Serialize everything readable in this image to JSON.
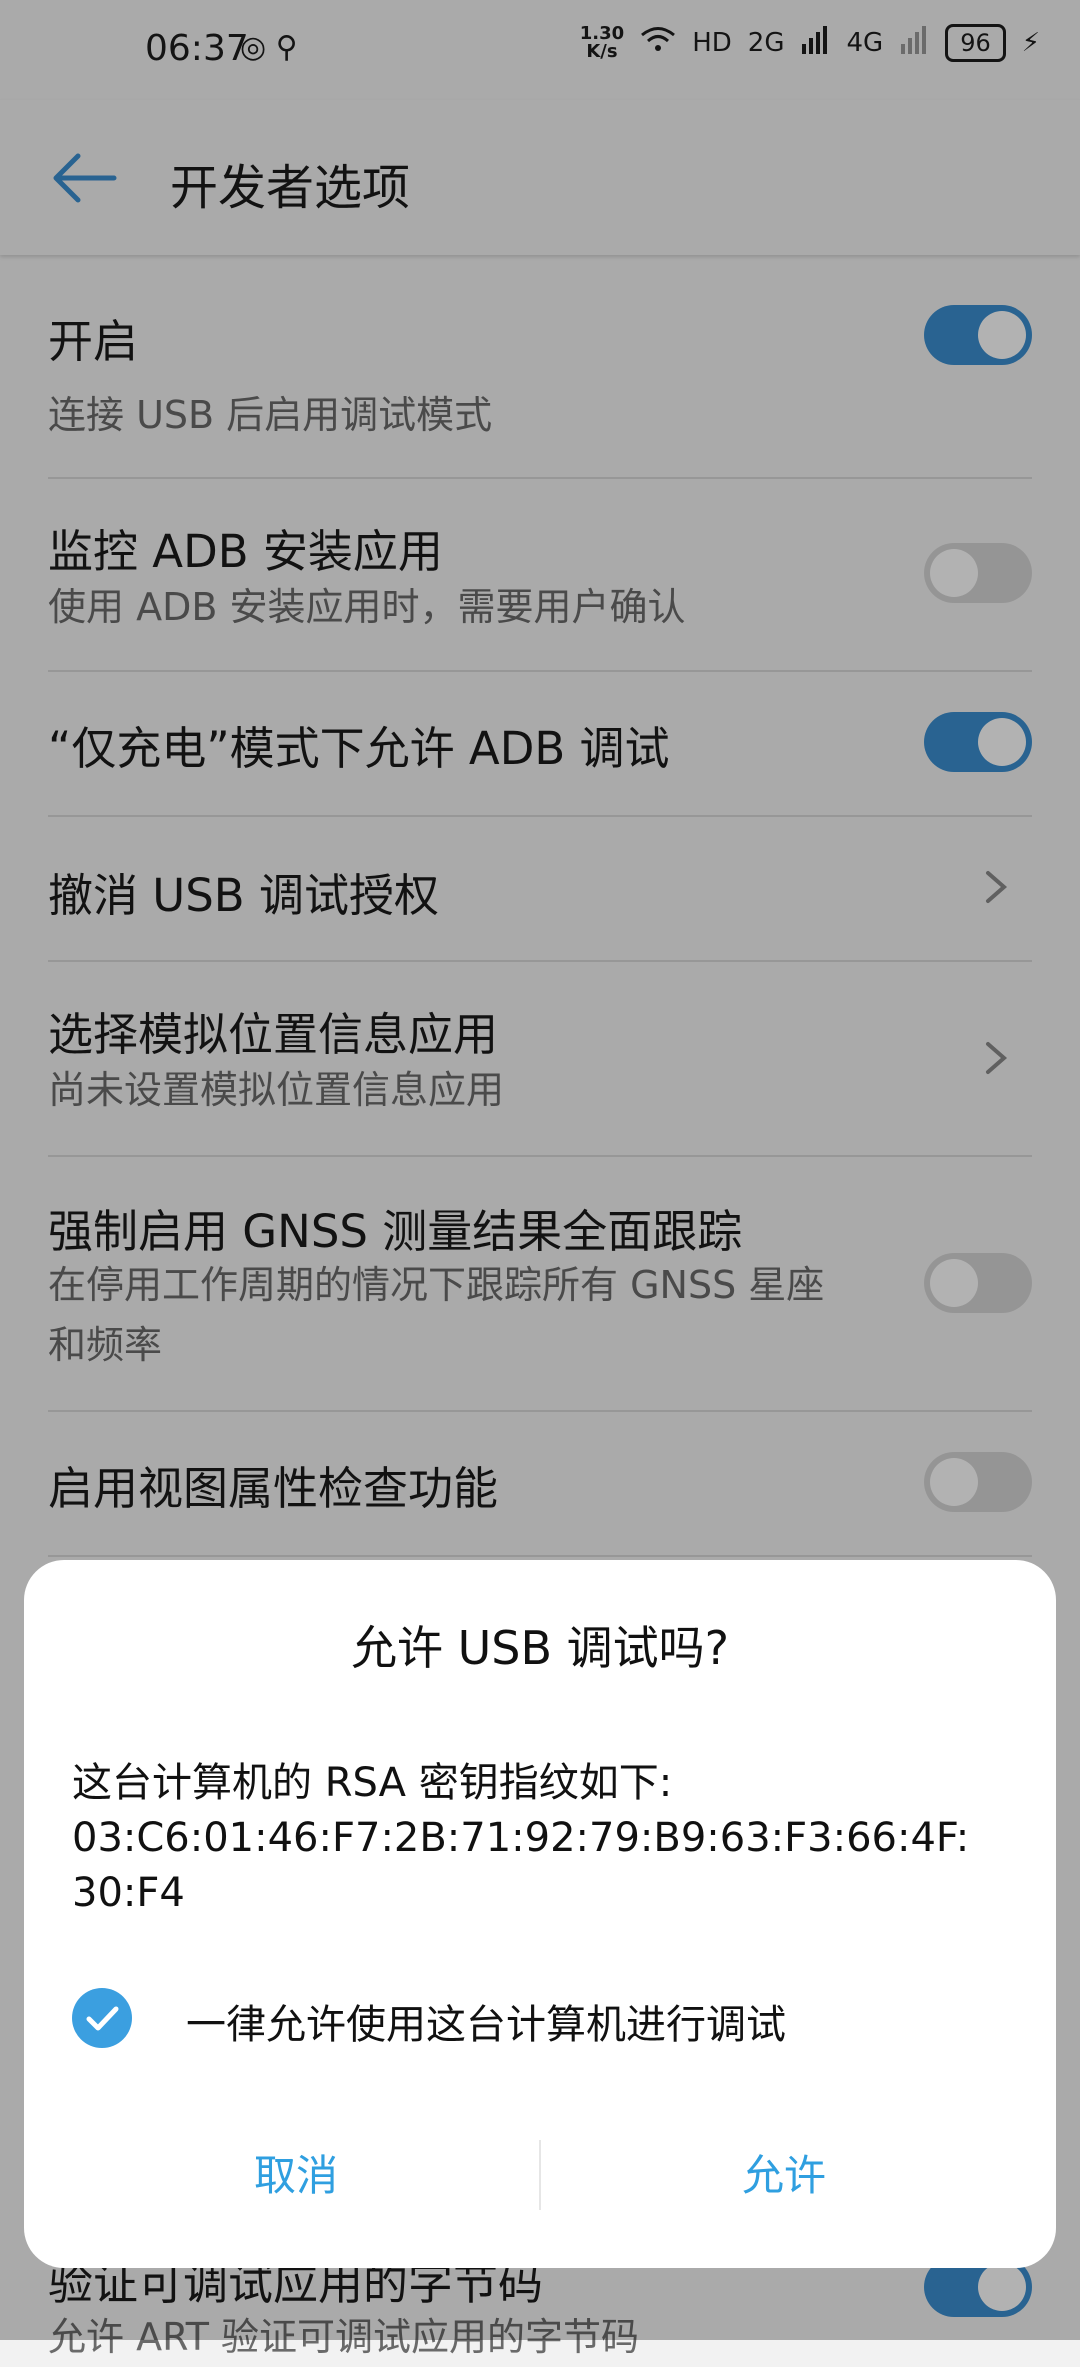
{
  "status_bar": {
    "time": "06:37",
    "net_speed_value": "1.30",
    "net_speed_unit": "K/s",
    "network_hd": "HD",
    "network_2g": "2G",
    "network_4g": "4G",
    "battery": "96"
  },
  "header": {
    "title": "开发者选项"
  },
  "settings": [
    {
      "title": "开启",
      "subtitle": "连接 USB 后启用调试模式",
      "control": "toggle",
      "on": true
    },
    {
      "title": "监控 ADB 安装应用",
      "subtitle": "使用 ADB 安装应用时，需要用户确认",
      "control": "toggle",
      "on": false
    },
    {
      "title": "“仅充电”模式下允许 ADB 调试",
      "subtitle": "",
      "control": "toggle",
      "on": true
    },
    {
      "title": "撤消 USB 调试授权",
      "subtitle": "",
      "control": "chevron"
    },
    {
      "title": "选择模拟位置信息应用",
      "subtitle": "尚未设置模拟位置信息应用",
      "control": "chevron"
    },
    {
      "title": "强制启用 GNSS 测量结果全面跟踪",
      "subtitle": "在停用工作周期的情况下跟踪所有 GNSS 星座和频率",
      "control": "toggle",
      "on": false
    },
    {
      "title": "启用视图属性检查功能",
      "subtitle": "",
      "control": "toggle",
      "on": false
    },
    {
      "title": "验证可调试应用的字节码",
      "subtitle": "允许 ART 验证可调试应用的字节码",
      "control": "toggle",
      "on": true
    }
  ],
  "dialog": {
    "title": "允许 USB 调试吗?",
    "message_line1": "这台计算机的 RSA 密钥指纹如下:",
    "message_line2": "03:C6:01:46:F7:2B:71:92:79:B9:63:F3:66:4F:",
    "message_line3": "30:F4",
    "checkbox_label": "一律允许使用这台计算机进行调试",
    "checkbox_checked": true,
    "cancel_label": "取消",
    "allow_label": "允许"
  },
  "colors": {
    "accent": "#3b8fd0",
    "dialog_button": "#2f9fe0"
  }
}
